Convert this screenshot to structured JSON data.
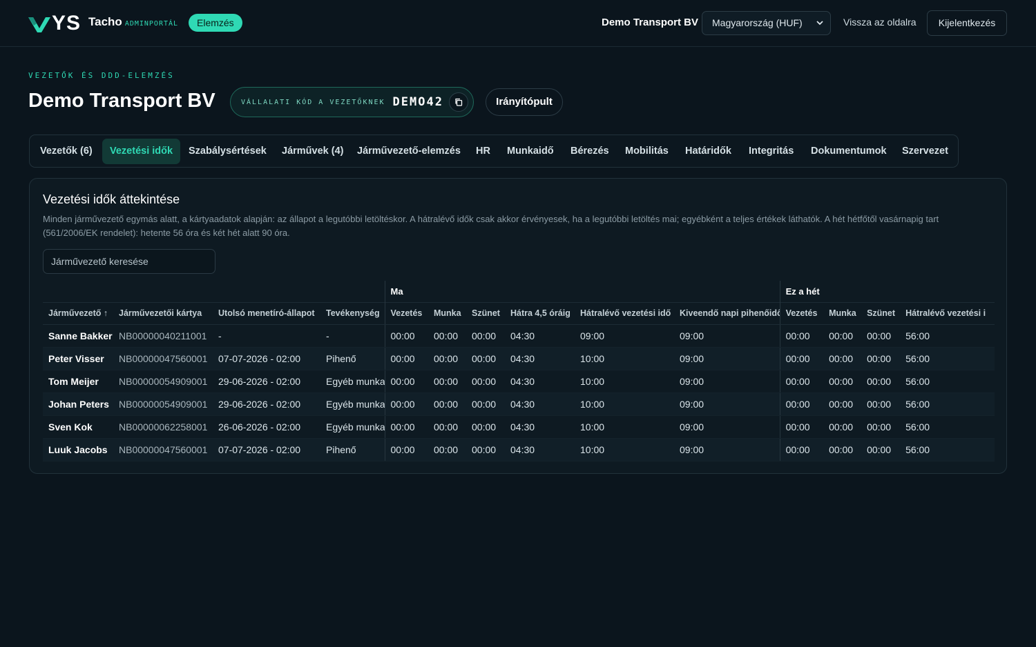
{
  "header": {
    "logo_text": "YS",
    "brand": "Tacho",
    "brand_sub": "ADMINPORTÁL",
    "badge": "Elemzés",
    "company": "Demo Transport BV",
    "country_select": "Magyarország (HUF)",
    "back_link": "Vissza az oldalra",
    "logout": "Kijelentkezés"
  },
  "page": {
    "eyebrow": "VEZETŐK ÉS DDD-ELEMZÉS",
    "title": "Demo Transport BV",
    "code_label": "VÁLLALATI KÓD A VEZETŐKNEK",
    "code_value": "DEMO42",
    "dashboard_button": "Irányítópult"
  },
  "tabs": [
    "Vezetők (6)",
    "Vezetési idők",
    "Szabálysértések",
    "Járművek (4)",
    "Járművezető-elemzés",
    "HR",
    "Munkaidő",
    "Bérezés",
    "Mobilitás",
    "Határidők",
    "Integritás",
    "Dokumentumok",
    "Szervezet"
  ],
  "panel": {
    "title": "Vezetési idők áttekintése",
    "description": "Minden járművezető egymás alatt, a kártyaadatok alapján: az állapot a legutóbbi letöltéskor. A hátralévő idők csak akkor érvényesek, ha a legutóbbi letöltés mai; egyébként a teljes értékek láthatók. A hét hétfőtől vasárnapig tart (561/2006/EK rendelet): hetente 56 óra és két hét alatt 90 óra.",
    "search_placeholder": "Járművezető keresése"
  },
  "table": {
    "group_today": "Ma",
    "group_week": "Ez a hét",
    "columns": [
      "Járművezető ↑",
      "Járművezetői kártya",
      "Utolsó menetíró-állapot",
      "Tevékenység",
      "Vezetés",
      "Munka",
      "Szünet",
      "Hátra 4,5 óráig",
      "Hátralévő vezetési idő",
      "Kiveendő napi pihenőidő",
      "Vezetés",
      "Munka",
      "Szünet",
      "Hátralévő vezetési i"
    ],
    "rows": [
      [
        "Sanne Bakker",
        "NB00000040211001",
        "-",
        "-",
        "00:00",
        "00:00",
        "00:00",
        "04:30",
        "09:00",
        "09:00",
        "00:00",
        "00:00",
        "00:00",
        "56:00"
      ],
      [
        "Peter Visser",
        "NB00000047560001",
        "07-07-2026 - 02:00",
        "Pihenő",
        "00:00",
        "00:00",
        "00:00",
        "04:30",
        "10:00",
        "09:00",
        "00:00",
        "00:00",
        "00:00",
        "56:00"
      ],
      [
        "Tom Meijer",
        "NB00000054909001",
        "29-06-2026 - 02:00",
        "Egyéb munka",
        "00:00",
        "00:00",
        "00:00",
        "04:30",
        "10:00",
        "09:00",
        "00:00",
        "00:00",
        "00:00",
        "56:00"
      ],
      [
        "Johan Peters",
        "NB00000054909001",
        "29-06-2026 - 02:00",
        "Egyéb munka",
        "00:00",
        "00:00",
        "00:00",
        "04:30",
        "10:00",
        "09:00",
        "00:00",
        "00:00",
        "00:00",
        "56:00"
      ],
      [
        "Sven Kok",
        "NB00000062258001",
        "26-06-2026 - 02:00",
        "Egyéb munka",
        "00:00",
        "00:00",
        "00:00",
        "04:30",
        "10:00",
        "09:00",
        "00:00",
        "00:00",
        "00:00",
        "56:00"
      ],
      [
        "Luuk Jacobs",
        "NB00000047560001",
        "07-07-2026 - 02:00",
        "Pihenő",
        "00:00",
        "00:00",
        "00:00",
        "04:30",
        "10:00",
        "09:00",
        "00:00",
        "00:00",
        "00:00",
        "56:00"
      ]
    ]
  },
  "colors": {
    "background": "#0b151d",
    "accent": "#2fd9b4",
    "panel": "#0e1a22"
  },
  "icons": {
    "logo": "vys-logo-icon",
    "copy": "copy-icon",
    "select": "chevron-down-icon",
    "sort": "arrow-up-icon"
  }
}
